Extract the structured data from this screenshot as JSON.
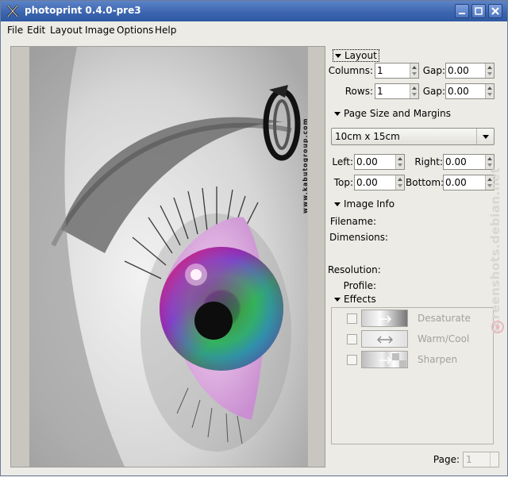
{
  "window": {
    "title": "photoprint 0.4.0-pre3"
  },
  "menubar": {
    "items": [
      "File",
      "Edit",
      "Layout",
      "Image",
      "Options",
      "Help"
    ]
  },
  "preview": {
    "logo_text": "www.kabutogroup.com"
  },
  "layout": {
    "header": "Layout",
    "columns_label": "Columns:",
    "columns_value": "1",
    "rows_label": "Rows:",
    "rows_value": "1",
    "gap_label": "Gap:",
    "gap_col_value": "0.00",
    "gap_row_value": "0.00"
  },
  "page_size": {
    "header": "Page Size and Margins",
    "size_value": "10cm x 15cm",
    "left_label": "Left:",
    "left_value": "0.00",
    "right_label": "Right:",
    "right_value": "0.00",
    "top_label": "Top:",
    "top_value": "0.00",
    "bottom_label": "Bottom:",
    "bottom_value": "0.00"
  },
  "image_info": {
    "header": "Image Info",
    "filename_label": "Filename:",
    "dimensions_label": "Dimensions:",
    "resolution_label": "Resolution:",
    "profile_label": "Profile:"
  },
  "effects": {
    "header": "Effects",
    "items": [
      {
        "label": "Desaturate",
        "icon": "desaturate-icon"
      },
      {
        "label": "Warm/Cool",
        "icon": "warm-cool-icon"
      },
      {
        "label": "Sharpen",
        "icon": "sharpen-icon"
      }
    ]
  },
  "footer": {
    "page_label": "Page:",
    "page_value": "1"
  },
  "watermark": "screenshots.debian.net",
  "colors": {
    "titlebar": "#3a64ae",
    "background": "#ecebe6",
    "disabled_text": "#a3a19a"
  }
}
